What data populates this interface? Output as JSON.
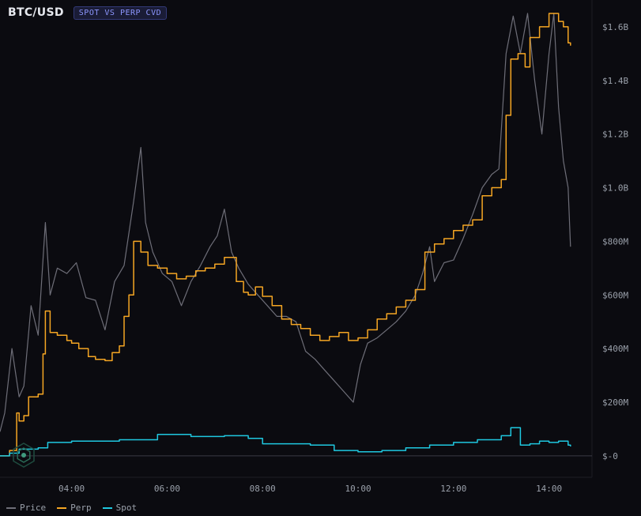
{
  "header": {
    "symbol": "BTC/USD",
    "badge": "SPOT VS PERP CVD"
  },
  "colors": {
    "background": "#0b0b10",
    "price": "#6e6e78",
    "perp": "#f5a623",
    "spot": "#1fc8e0",
    "grid": "#1c1d24",
    "axis_text": "#9aa0aa"
  },
  "legend": [
    {
      "name": "Price",
      "color": "#6e6e78"
    },
    {
      "name": "Perp",
      "color": "#f5a623"
    },
    {
      "name": "Spot",
      "color": "#1fc8e0"
    }
  ],
  "chart_data": {
    "type": "line",
    "x_unit": "time (hours)",
    "xlim": [
      2.5,
      14.9
    ],
    "x_ticks": [
      {
        "value": 4,
        "label": "04:00"
      },
      {
        "value": 6,
        "label": "06:00"
      },
      {
        "value": 8,
        "label": "08:00"
      },
      {
        "value": 10,
        "label": "10:00"
      },
      {
        "value": 12,
        "label": "12:00"
      },
      {
        "value": 14,
        "label": "14:00"
      }
    ],
    "ylim": [
      -80,
      1700
    ],
    "y_unit": "USD (millions)",
    "y_ticks": [
      {
        "value": 0,
        "label": "$-0"
      },
      {
        "value": 200,
        "label": "$200M"
      },
      {
        "value": 400,
        "label": "$400M"
      },
      {
        "value": 600,
        "label": "$600M"
      },
      {
        "value": 800,
        "label": "$800M"
      },
      {
        "value": 1000,
        "label": "$1.0B"
      },
      {
        "value": 1200,
        "label": "$1.2B"
      },
      {
        "value": 1400,
        "label": "$1.4B"
      },
      {
        "value": 1600,
        "label": "$1.6B"
      }
    ],
    "series": [
      {
        "name": "Perp",
        "color": "#f5a623",
        "points": [
          [
            2.5,
            0
          ],
          [
            2.7,
            20
          ],
          [
            2.85,
            160
          ],
          [
            2.9,
            130
          ],
          [
            3.0,
            150
          ],
          [
            3.1,
            220
          ],
          [
            3.3,
            230
          ],
          [
            3.4,
            380
          ],
          [
            3.45,
            540
          ],
          [
            3.55,
            460
          ],
          [
            3.7,
            450
          ],
          [
            3.9,
            430
          ],
          [
            4.0,
            420
          ],
          [
            4.15,
            400
          ],
          [
            4.35,
            370
          ],
          [
            4.5,
            360
          ],
          [
            4.7,
            355
          ],
          [
            4.85,
            385
          ],
          [
            5.0,
            410
          ],
          [
            5.1,
            520
          ],
          [
            5.2,
            600
          ],
          [
            5.3,
            800
          ],
          [
            5.45,
            760
          ],
          [
            5.6,
            710
          ],
          [
            5.8,
            700
          ],
          [
            6.0,
            680
          ],
          [
            6.2,
            660
          ],
          [
            6.4,
            670
          ],
          [
            6.6,
            690
          ],
          [
            6.8,
            700
          ],
          [
            7.0,
            715
          ],
          [
            7.2,
            740
          ],
          [
            7.35,
            740
          ],
          [
            7.45,
            650
          ],
          [
            7.6,
            610
          ],
          [
            7.7,
            600
          ],
          [
            7.85,
            630
          ],
          [
            8.0,
            595
          ],
          [
            8.2,
            560
          ],
          [
            8.4,
            510
          ],
          [
            8.6,
            490
          ],
          [
            8.8,
            475
          ],
          [
            9.0,
            450
          ],
          [
            9.2,
            430
          ],
          [
            9.4,
            445
          ],
          [
            9.6,
            460
          ],
          [
            9.8,
            430
          ],
          [
            10.0,
            440
          ],
          [
            10.2,
            470
          ],
          [
            10.4,
            510
          ],
          [
            10.6,
            530
          ],
          [
            10.8,
            555
          ],
          [
            11.0,
            580
          ],
          [
            11.2,
            620
          ],
          [
            11.4,
            760
          ],
          [
            11.6,
            790
          ],
          [
            11.8,
            810
          ],
          [
            12.0,
            840
          ],
          [
            12.2,
            860
          ],
          [
            12.4,
            880
          ],
          [
            12.6,
            970
          ],
          [
            12.8,
            1000
          ],
          [
            13.0,
            1030
          ],
          [
            13.1,
            1270
          ],
          [
            13.2,
            1480
          ],
          [
            13.35,
            1500
          ],
          [
            13.5,
            1450
          ],
          [
            13.6,
            1560
          ],
          [
            13.8,
            1600
          ],
          [
            14.0,
            1650
          ],
          [
            14.2,
            1620
          ],
          [
            14.3,
            1600
          ],
          [
            14.4,
            1540
          ],
          [
            14.45,
            1530
          ]
        ]
      },
      {
        "name": "Spot",
        "color": "#1fc8e0",
        "points": [
          [
            2.5,
            0
          ],
          [
            2.7,
            10
          ],
          [
            2.9,
            25
          ],
          [
            3.3,
            30
          ],
          [
            3.5,
            50
          ],
          [
            4.0,
            55
          ],
          [
            5.0,
            60
          ],
          [
            5.8,
            80
          ],
          [
            6.5,
            72
          ],
          [
            7.2,
            75
          ],
          [
            7.7,
            65
          ],
          [
            8.0,
            45
          ],
          [
            9.0,
            40
          ],
          [
            9.5,
            20
          ],
          [
            10.0,
            15
          ],
          [
            10.5,
            20
          ],
          [
            11.0,
            30
          ],
          [
            11.5,
            40
          ],
          [
            12.0,
            50
          ],
          [
            12.5,
            60
          ],
          [
            13.0,
            75
          ],
          [
            13.2,
            105
          ],
          [
            13.4,
            40
          ],
          [
            13.6,
            45
          ],
          [
            13.8,
            55
          ],
          [
            14.0,
            50
          ],
          [
            14.2,
            55
          ],
          [
            14.4,
            40
          ],
          [
            14.45,
            35
          ]
        ]
      },
      {
        "name": "Price",
        "color": "#6e6e78",
        "points": [
          [
            2.5,
            90
          ],
          [
            2.6,
            160
          ],
          [
            2.75,
            400
          ],
          [
            2.9,
            220
          ],
          [
            3.0,
            260
          ],
          [
            3.15,
            560
          ],
          [
            3.3,
            450
          ],
          [
            3.45,
            870
          ],
          [
            3.55,
            600
          ],
          [
            3.7,
            700
          ],
          [
            3.9,
            680
          ],
          [
            4.1,
            720
          ],
          [
            4.3,
            590
          ],
          [
            4.5,
            580
          ],
          [
            4.7,
            470
          ],
          [
            4.9,
            650
          ],
          [
            5.1,
            710
          ],
          [
            5.3,
            950
          ],
          [
            5.45,
            1150
          ],
          [
            5.55,
            870
          ],
          [
            5.7,
            760
          ],
          [
            5.9,
            680
          ],
          [
            6.1,
            650
          ],
          [
            6.3,
            560
          ],
          [
            6.5,
            650
          ],
          [
            6.7,
            710
          ],
          [
            6.9,
            780
          ],
          [
            7.05,
            820
          ],
          [
            7.2,
            920
          ],
          [
            7.35,
            760
          ],
          [
            7.5,
            700
          ],
          [
            7.7,
            640
          ],
          [
            7.9,
            600
          ],
          [
            8.1,
            560
          ],
          [
            8.3,
            520
          ],
          [
            8.5,
            520
          ],
          [
            8.7,
            500
          ],
          [
            8.9,
            390
          ],
          [
            9.1,
            360
          ],
          [
            9.3,
            320
          ],
          [
            9.5,
            280
          ],
          [
            9.7,
            240
          ],
          [
            9.9,
            200
          ],
          [
            10.05,
            340
          ],
          [
            10.2,
            420
          ],
          [
            10.4,
            440
          ],
          [
            10.6,
            470
          ],
          [
            10.8,
            500
          ],
          [
            11.0,
            540
          ],
          [
            11.2,
            600
          ],
          [
            11.35,
            680
          ],
          [
            11.5,
            780
          ],
          [
            11.6,
            650
          ],
          [
            11.8,
            720
          ],
          [
            12.0,
            730
          ],
          [
            12.2,
            810
          ],
          [
            12.4,
            900
          ],
          [
            12.6,
            1000
          ],
          [
            12.8,
            1050
          ],
          [
            12.95,
            1070
          ],
          [
            13.1,
            1500
          ],
          [
            13.25,
            1640
          ],
          [
            13.4,
            1500
          ],
          [
            13.55,
            1650
          ],
          [
            13.7,
            1400
          ],
          [
            13.85,
            1200
          ],
          [
            14.0,
            1500
          ],
          [
            14.1,
            1650
          ],
          [
            14.2,
            1300
          ],
          [
            14.3,
            1100
          ],
          [
            14.4,
            1000
          ],
          [
            14.45,
            780
          ]
        ]
      }
    ]
  }
}
